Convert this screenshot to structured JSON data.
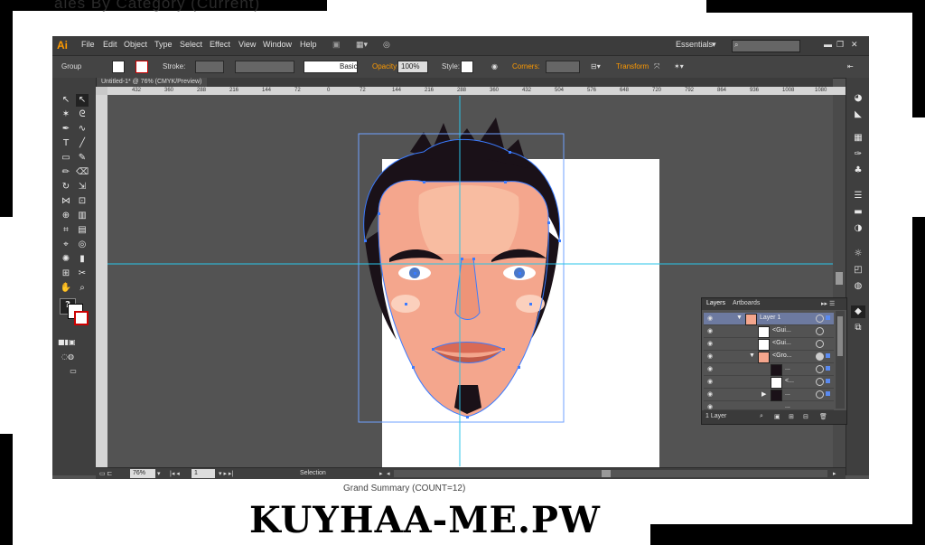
{
  "background": {
    "title_text": "ales By Category (Current)",
    "summary_text": "Grand Summary (COUNT=12)"
  },
  "app": {
    "logo": "Ai",
    "menus": [
      "File",
      "Edit",
      "Object",
      "Type",
      "Select",
      "Effect",
      "View",
      "Window",
      "Help"
    ],
    "workspace": "Essentials",
    "search_icon": "search-icon"
  },
  "control": {
    "group_label": "Group",
    "stroke_label": "Stroke:",
    "brush_label": "Basic",
    "opacity_label": "Opacity:",
    "opacity_value": "100%",
    "style_label": "Style:",
    "corners_label": "Corners:",
    "transform_label": "Transform"
  },
  "document": {
    "tab_title": "Untitled-1* @ 76% (CMYK/Preview)"
  },
  "ruler": {
    "ticks": [
      "432",
      "360",
      "288",
      "216",
      "144",
      "72",
      "0",
      "72",
      "144",
      "216",
      "288",
      "360",
      "432",
      "504",
      "576",
      "648",
      "720",
      "792",
      "864",
      "936",
      "1008",
      "1080"
    ]
  },
  "status": {
    "zoom": "76%",
    "artboard": "1",
    "tool": "Selection"
  },
  "layers_panel": {
    "tabs": [
      "Layers",
      "Artboards"
    ],
    "rows": [
      "Layer 1",
      "<Gui...",
      "<Gui...",
      "<Gro...",
      "...",
      "<...",
      "...",
      "..."
    ],
    "footer": "1 Layer"
  },
  "watermark": "KUYHAA-ME.PW",
  "colors": {
    "accent": "#ff9a00",
    "guide": "#29c4e8",
    "skin": "#f4a68d",
    "hair": "#1a1118",
    "lips": "#d96a55",
    "selection": "#3b7bff"
  }
}
